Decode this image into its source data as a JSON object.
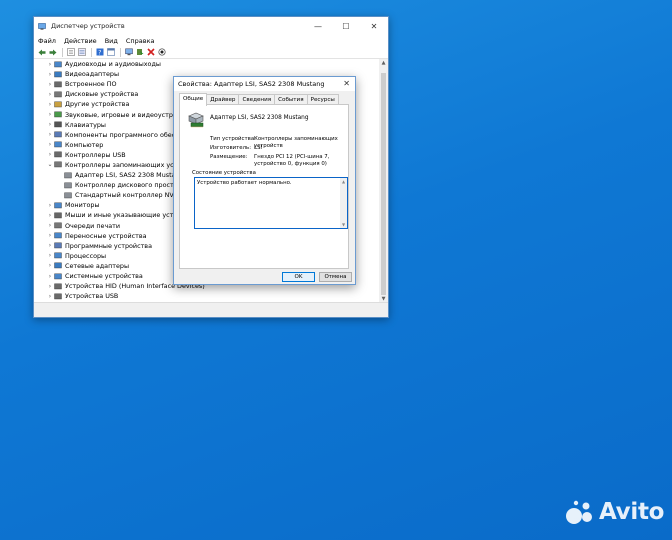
{
  "window": {
    "title": "Диспетчер устройств"
  },
  "menu": [
    "Файл",
    "Действие",
    "Вид",
    "Справка"
  ],
  "tree": [
    {
      "label": "Аудиовходы и аудиовыходы",
      "depth": 1,
      "expanded": false
    },
    {
      "label": "Видеоадаптеры",
      "depth": 1,
      "expanded": false
    },
    {
      "label": "Встроенное ПО",
      "depth": 1,
      "expanded": false
    },
    {
      "label": "Дисковые устройства",
      "depth": 1,
      "expanded": false
    },
    {
      "label": "Другие устройства",
      "depth": 1,
      "expanded": false
    },
    {
      "label": "Звуковые, игровые и видеоустройства",
      "depth": 1,
      "expanded": false
    },
    {
      "label": "Клавиатуры",
      "depth": 1,
      "expanded": false
    },
    {
      "label": "Компоненты программного обеспече",
      "depth": 1,
      "expanded": false
    },
    {
      "label": "Компьютер",
      "depth": 1,
      "expanded": false
    },
    {
      "label": "Контроллеры USB",
      "depth": 1,
      "expanded": false
    },
    {
      "label": "Контроллеры запоминающих устройств",
      "depth": 1,
      "expanded": true
    },
    {
      "label": "Адаптер LSI, SAS2 2308 Mustang",
      "depth": 2
    },
    {
      "label": "Контроллер дискового пространст",
      "depth": 2
    },
    {
      "label": "Стандартный контроллер NVM Ex",
      "depth": 2
    },
    {
      "label": "Мониторы",
      "depth": 1,
      "expanded": false
    },
    {
      "label": "Мыши и иные указывающие устройств",
      "depth": 1,
      "expanded": false
    },
    {
      "label": "Очереди печати",
      "depth": 1,
      "expanded": false
    },
    {
      "label": "Переносные устройства",
      "depth": 1,
      "expanded": false
    },
    {
      "label": "Программные устройства",
      "depth": 1,
      "expanded": false
    },
    {
      "label": "Процессоры",
      "depth": 1,
      "expanded": false
    },
    {
      "label": "Сетевые адаптеры",
      "depth": 1,
      "expanded": false
    },
    {
      "label": "Системные устройства",
      "depth": 1,
      "expanded": false
    },
    {
      "label": "Устройства HID (Human Interface Devices)",
      "depth": 1,
      "expanded": false
    },
    {
      "label": "Устройства USB",
      "depth": 1,
      "expanded": false
    }
  ],
  "dialog": {
    "title": "Свойства: Адаптер LSI, SAS2 2308 Mustang",
    "tabs": [
      "Общие",
      "Драйвер",
      "Сведения",
      "События",
      "Ресурсы"
    ],
    "active_tab": "Общие",
    "device_name": "Адаптер LSI, SAS2 2308 Mustang",
    "props": [
      {
        "label": "Тип устройства:",
        "value": "Контроллеры запоминающих устройств"
      },
      {
        "label": "Изготовитель:",
        "value": "LSI"
      },
      {
        "label": "Размещение:",
        "value": "Гнездо PCI 12 (PCI-шина 7, устройство 0, функция 0)"
      }
    ],
    "status_label": "Состояние устройства",
    "status_text": "Устройство работает нормально.",
    "ok_label": "OK",
    "cancel_label": "Отмена"
  },
  "watermark": {
    "text": "Avito"
  },
  "colors": {
    "desktop": "#0f78d4",
    "accent": "#0078d7"
  }
}
